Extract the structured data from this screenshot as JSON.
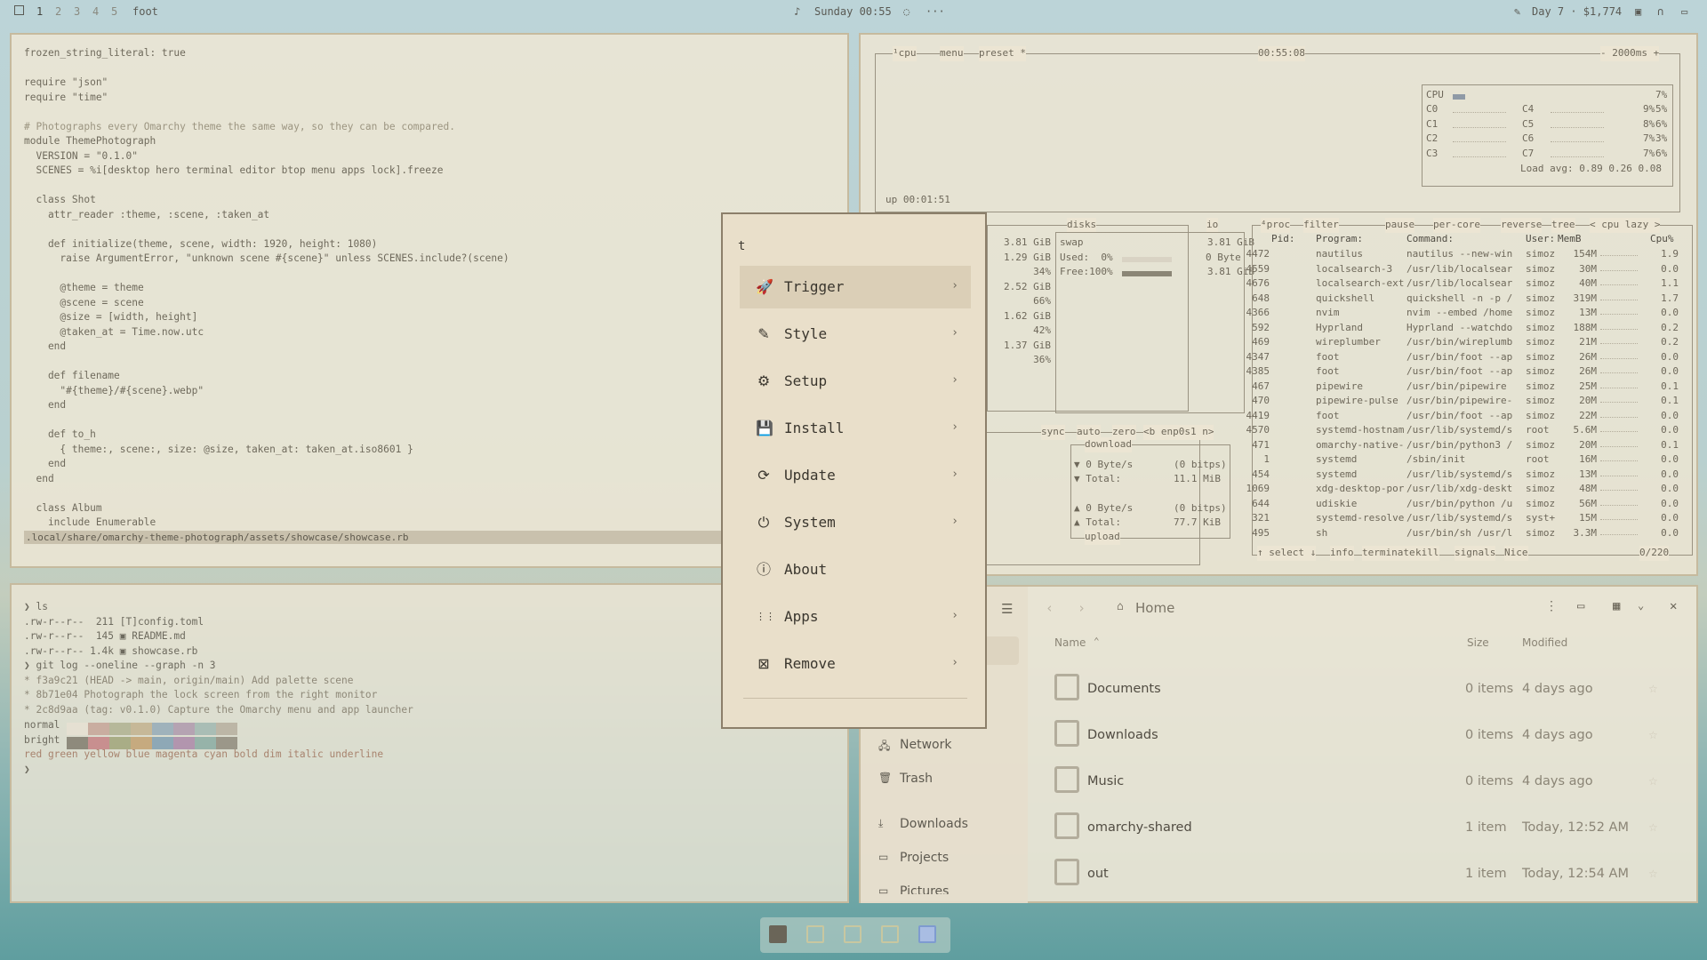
{
  "topbar": {
    "workspaces": [
      "1",
      "2",
      "3",
      "4",
      "5"
    ],
    "active_app": "foot",
    "clock": "Sunday 00:55",
    "more": "···",
    "tracker": "Day 7 · $1,774"
  },
  "editor": {
    "lines": [
      "frozen_string_literal: true",
      "",
      "require \"json\"",
      "require \"time\"",
      "",
      "# Photographs every Omarchy theme the same way, so they can be compared.",
      "module ThemePhotograph",
      "  VERSION = \"0.1.0\"",
      "  SCENES = %i[desktop hero terminal editor btop menu apps lock].freeze",
      "",
      "  class Shot",
      "    attr_reader :theme, :scene, :taken_at",
      "",
      "    def initialize(theme, scene, width: 1920, height: 1080)",
      "      raise ArgumentError, \"unknown scene #{scene}\" unless SCENES.include?(scene)",
      "",
      "      @theme = theme",
      "      @scene = scene",
      "      @size = [width, height]",
      "      @taken_at = Time.now.utc",
      "    end",
      "",
      "    def filename",
      "      \"#{theme}/#{scene}.webp\"",
      "    end",
      "",
      "    def to_h",
      "      { theme:, scene:, size: @size, taken_at: taken_at.iso8601 }",
      "    end",
      "  end",
      "",
      "  class Album",
      "    include Enumerable"
    ],
    "status_path": ".local/share/omarchy-theme-photograph/assets/showcase/showcase.rb"
  },
  "btop": {
    "header_left": "¹cpu",
    "header_menu": "menu",
    "header_preset": "preset *",
    "clock": "00:55:08",
    "interval": "- 2000ms +",
    "uptime": "up 00:01:51",
    "cpu_label": "CPU",
    "cpu_total": "7%",
    "cores": [
      {
        "l": "C0",
        "v": "9%",
        "r": "C4",
        "rv": "5%"
      },
      {
        "l": "C1",
        "v": "8%",
        "r": "C5",
        "rv": "6%"
      },
      {
        "l": "C2",
        "v": "7%",
        "r": "C6",
        "rv": "3%"
      },
      {
        "l": "C3",
        "v": "7%",
        "r": "C7",
        "rv": "6%"
      }
    ],
    "load_avg": "Load avg: 0.89 0.26 0.08",
    "mem_values": [
      "3.81 GiB",
      "1.29 GiB",
      "34%",
      "2.52 GiB",
      "66%",
      "1.62 GiB",
      "42%",
      "1.37 GiB",
      "36%"
    ],
    "disks_title": "disks",
    "io_title": "io",
    "swap_label": "swap",
    "swap_total": "3.81 GiB",
    "swap_used": "Used:  0%",
    "swap_used_val": "0 Byte",
    "swap_free": "Free:100%",
    "swap_free_val": "3.81 GiB",
    "net_header": [
      "sync",
      "auto",
      "zero",
      "<b enp0s1 n>"
    ],
    "net_download": "download",
    "net_rows": [
      {
        "a": "▼ 0 Byte/s",
        "b": "(0 bitps)"
      },
      {
        "a": "▼ Total:",
        "b": "11.1 MiB"
      },
      {
        "a": "▲ 0 Byte/s",
        "b": "(0 bitps)"
      },
      {
        "a": "▲ Total:",
        "b": "77.7 KiB"
      }
    ],
    "net_upload": "upload",
    "proc_header": [
      "⁴proc",
      "filter",
      "pause",
      "per-core",
      "reverse",
      "tree",
      "< cpu lazy >"
    ],
    "proc_cols": [
      "Pid:",
      "Program:",
      "Command:",
      "User:",
      "MemB",
      "Cpu%"
    ],
    "procs": [
      [
        "4472",
        "nautilus",
        "nautilus --new-win",
        "simoz",
        "154M",
        "1.9"
      ],
      [
        "4559",
        "localsearch-3",
        "/usr/lib/localsear",
        "simoz",
        "30M",
        "0.0"
      ],
      [
        "4676",
        "localsearch-ext",
        "/usr/lib/localsear",
        "simoz",
        "40M",
        "1.1"
      ],
      [
        "648",
        "quickshell",
        "quickshell -n -p /",
        "simoz",
        "319M",
        "1.7"
      ],
      [
        "4366",
        "nvim",
        "nvim --embed /home",
        "simoz",
        "13M",
        "0.0"
      ],
      [
        "592",
        "Hyprland",
        "Hyprland --watchdo",
        "simoz",
        "188M",
        "0.2"
      ],
      [
        "469",
        "wireplumber",
        "/usr/bin/wireplumb",
        "simoz",
        "21M",
        "0.2"
      ],
      [
        "4347",
        "foot",
        "/usr/bin/foot --ap",
        "simoz",
        "26M",
        "0.0"
      ],
      [
        "4385",
        "foot",
        "/usr/bin/foot --ap",
        "simoz",
        "26M",
        "0.0"
      ],
      [
        "467",
        "pipewire",
        "/usr/bin/pipewire",
        "simoz",
        "25M",
        "0.1"
      ],
      [
        "470",
        "pipewire-pulse",
        "/usr/bin/pipewire-",
        "simoz",
        "20M",
        "0.1"
      ],
      [
        "4419",
        "foot",
        "/usr/bin/foot --ap",
        "simoz",
        "22M",
        "0.0"
      ],
      [
        "4570",
        "systemd-hostnam",
        "/usr/lib/systemd/s",
        "root",
        "5.6M",
        "0.0"
      ],
      [
        "471",
        "omarchy-native-",
        "/usr/bin/python3 /",
        "simoz",
        "20M",
        "0.1"
      ],
      [
        "1",
        "systemd",
        "/sbin/init",
        "root",
        "16M",
        "0.0"
      ],
      [
        "454",
        "systemd",
        "/usr/lib/systemd/s",
        "simoz",
        "13M",
        "0.0"
      ],
      [
        "1069",
        "xdg-desktop-por",
        "/usr/lib/xdg-deskt",
        "simoz",
        "48M",
        "0.0"
      ],
      [
        "644",
        "udiskie",
        "/usr/bin/python /u",
        "simoz",
        "56M",
        "0.0"
      ],
      [
        "321",
        "systemd-resolve",
        "/usr/lib/systemd/s",
        "syst+",
        "15M",
        "0.0"
      ],
      [
        "495",
        "sh",
        "/usr/bin/sh /usr/l",
        "simoz",
        "3.3M",
        "0.0"
      ]
    ],
    "proc_footer": [
      "↑ select ↓",
      "info",
      "terminate",
      "kill",
      "signals",
      "Nice"
    ],
    "proc_count": "0/220"
  },
  "terminal": {
    "lines": [
      "❯ ls",
      ".rw-r--r--  211 [T]config.toml",
      ".rw-r--r--  145 ▣ README.md",
      ".rw-r--r-- 1.4k ▣ showcase.rb",
      "❯ git log --oneline --graph -n 3",
      "* f3a9c21 (HEAD -> main, origin/main) Add palette scene",
      "* 8b71e04 Photograph the lock screen from the right monitor",
      "* 2c8d9aa (tag: v0.1.0) Capture the Omarchy menu and app launcher"
    ],
    "normal_label": "normal",
    "bright_label": "bright",
    "styles_line": "red green yellow blue magenta cyan bold dim italic underline",
    "prompt": "❯",
    "normal_colors": [
      "#e5e0d2",
      "#c9ada0",
      "#b6b89a",
      "#c6b898",
      "#9fb2bb",
      "#b5a3b2",
      "#a9bdb5",
      "#bcb6a6"
    ],
    "bright_colors": [
      "#8e8a7c",
      "#c88f8f",
      "#a9ad86",
      "#c6aa7f",
      "#8ea8b6",
      "#b295ae",
      "#96b3a9",
      "#9b9789"
    ]
  },
  "menu": {
    "query": "t",
    "items": [
      {
        "label": "Trigger",
        "icon": "rocket-icon",
        "glyph": "🚀",
        "chevron": "›",
        "selected": true
      },
      {
        "label": "Style",
        "icon": "wand-icon",
        "glyph": "✎",
        "chevron": "›",
        "selected": false
      },
      {
        "label": "Setup",
        "icon": "gear-icon",
        "glyph": "⚙",
        "chevron": "›",
        "selected": false
      },
      {
        "label": "Install",
        "icon": "floppy-icon",
        "glyph": "💾",
        "chevron": "›",
        "selected": false
      },
      {
        "label": "Update",
        "icon": "refresh-icon",
        "glyph": "⟳",
        "chevron": "›",
        "selected": false
      },
      {
        "label": "System",
        "icon": "power-icon",
        "glyph": "⏻",
        "chevron": "›",
        "selected": false
      },
      {
        "label": "About",
        "icon": "info-icon",
        "glyph": "ⓘ",
        "chevron": "",
        "selected": false
      },
      {
        "label": "Apps",
        "icon": "grid-icon",
        "glyph": "⋮⋮",
        "chevron": "›",
        "selected": false
      },
      {
        "label": "Remove",
        "icon": "remove-icon",
        "glyph": "⊠",
        "chevron": "›",
        "selected": false
      }
    ]
  },
  "files": {
    "location": "Home",
    "col_name": "Name",
    "col_size": "Size",
    "col_modified": "Modified",
    "sidebar": [
      {
        "label": "Network",
        "icon": "network-icon",
        "glyph": "🖧"
      },
      {
        "label": "Trash",
        "icon": "trash-icon",
        "glyph": "🗑"
      },
      {
        "label": "Downloads",
        "icon": "download-icon",
        "glyph": "⤓"
      },
      {
        "label": "Projects",
        "icon": "folder-icon",
        "glyph": "▭"
      },
      {
        "label": "Pictures",
        "icon": "folder-icon",
        "glyph": "▭"
      }
    ],
    "rows": [
      {
        "name": "Documents",
        "size": "0 items",
        "modified": "4 days ago",
        "icon": "document-folder-icon"
      },
      {
        "name": "Downloads",
        "size": "0 items",
        "modified": "4 days ago",
        "icon": "download-folder-icon"
      },
      {
        "name": "Music",
        "size": "0 items",
        "modified": "4 days ago",
        "icon": "music-folder-icon"
      },
      {
        "name": "omarchy-shared",
        "size": "1 item",
        "modified": "Today, 12:52 AM",
        "icon": "folder-icon"
      },
      {
        "name": "out",
        "size": "1 item",
        "modified": "Today, 12:54 AM",
        "icon": "folder-icon"
      }
    ]
  }
}
